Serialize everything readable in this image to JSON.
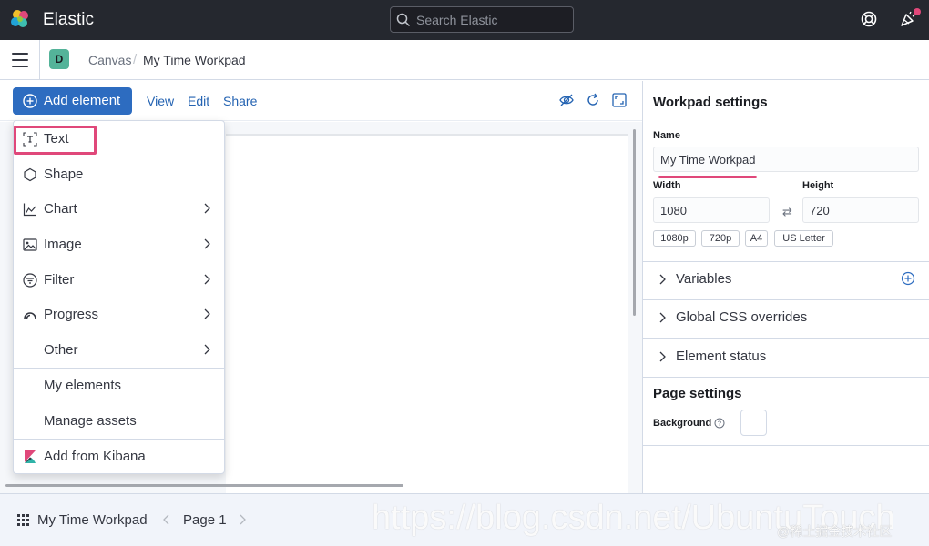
{
  "header": {
    "brand": "Elastic",
    "search_placeholder": "Search Elastic",
    "icons": [
      "elastic-logo",
      "help-lifebuoy-icon",
      "newsfeed-icon"
    ],
    "colors": {
      "bar_bg": "#25282f",
      "notification_dot": "#e0487a"
    }
  },
  "breadcrumb": {
    "space_initial": "D",
    "items": [
      "Canvas",
      "My Time Workpad"
    ]
  },
  "toolbar": {
    "add_element_label": "Add element",
    "view_label": "View",
    "edit_label": "Edit",
    "share_label": "Share",
    "icons": [
      "hide-editing-controls-icon",
      "refresh-icon",
      "fullscreen-icon"
    ],
    "accent": "#2d6cc0"
  },
  "add_menu": {
    "items": [
      {
        "label": "Text",
        "icon": "text-icon",
        "submenu": false,
        "highlighted": true
      },
      {
        "label": "Shape",
        "icon": "shape-icon",
        "submenu": false
      },
      {
        "label": "Chart",
        "icon": "chart-icon",
        "submenu": true
      },
      {
        "label": "Image",
        "icon": "image-icon",
        "submenu": true
      },
      {
        "label": "Filter",
        "icon": "filter-icon",
        "submenu": true
      },
      {
        "label": "Progress",
        "icon": "progress-icon",
        "submenu": true
      },
      {
        "label": "Other",
        "icon": "",
        "submenu": true
      }
    ],
    "secondary": [
      "My elements",
      "Manage assets"
    ],
    "kibana": {
      "label": "Add from Kibana",
      "icon": "kibana-icon"
    },
    "highlight_color": "#e0487a"
  },
  "workpad_settings": {
    "title": "Workpad settings",
    "name_label": "Name",
    "name_value": "My Time Workpad",
    "width_label": "Width",
    "width_value": "1080",
    "height_label": "Height",
    "height_value": "720",
    "presets": [
      "1080p",
      "720p",
      "A4",
      "US Letter"
    ],
    "accordions": [
      "Variables",
      "Global CSS overrides",
      "Element status"
    ]
  },
  "page_settings": {
    "title": "Page settings",
    "background_label": "Background",
    "background_color": "#ffffff"
  },
  "footer": {
    "workpad_name": "My Time Workpad",
    "page_label": "Page 1"
  },
  "watermark": {
    "url": "https://blog.csdn.net/UbuntuTouch",
    "handle": "@稀土掘金技术社区"
  }
}
